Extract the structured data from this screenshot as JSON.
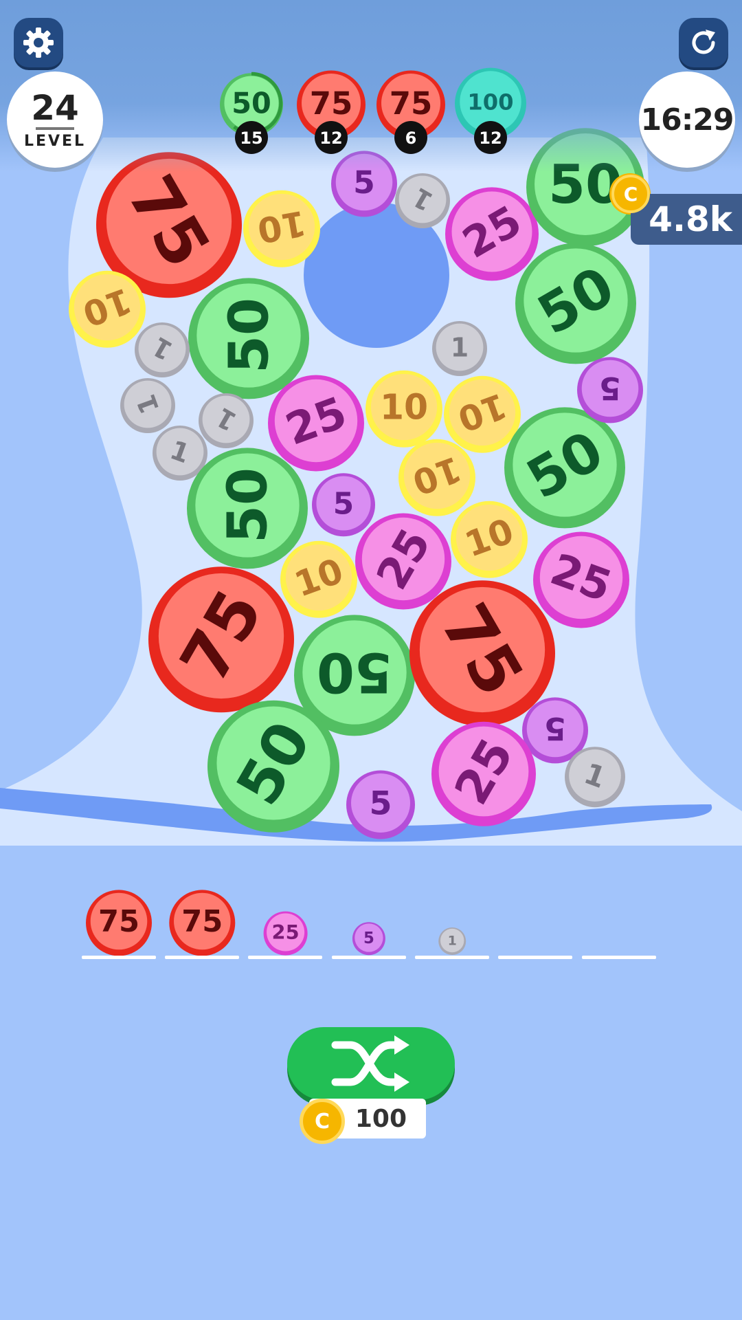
{
  "hud": {
    "level_number": "24",
    "level_label": "LEVEL",
    "timer": "16:29",
    "coin_balance": "4.8k",
    "coin_symbol": "C",
    "settings_icon": "gear-icon",
    "restart_icon": "restart-icon"
  },
  "goals": [
    {
      "value": "50",
      "count": "15",
      "color": "green",
      "progress": 0.6
    },
    {
      "value": "75",
      "count": "12",
      "color": "red"
    },
    {
      "value": "75",
      "count": "6",
      "color": "red"
    },
    {
      "value": "100",
      "count": "12",
      "color": "teal"
    }
  ],
  "board": {
    "coins": [
      {
        "value": "75",
        "color": "red"
      },
      {
        "value": "10",
        "color": "yellow"
      },
      {
        "value": "5",
        "color": "purple"
      },
      {
        "value": "1",
        "color": "gray"
      },
      {
        "value": "25",
        "color": "pink"
      },
      {
        "value": "50",
        "color": "green"
      },
      {
        "value": "10",
        "color": "yellow"
      },
      {
        "value": "50",
        "color": "green"
      },
      {
        "value": "50",
        "color": "green"
      },
      {
        "value": "1",
        "color": "gray"
      },
      {
        "value": "1",
        "color": "gray"
      },
      {
        "value": "1",
        "color": "gray"
      },
      {
        "value": "1",
        "color": "gray"
      },
      {
        "value": "1",
        "color": "gray"
      },
      {
        "value": "25",
        "color": "pink"
      },
      {
        "value": "10",
        "color": "yellow"
      },
      {
        "value": "10",
        "color": "yellow"
      },
      {
        "value": "5",
        "color": "purple"
      },
      {
        "value": "50",
        "color": "green"
      },
      {
        "value": "10",
        "color": "yellow"
      },
      {
        "value": "50",
        "color": "green"
      },
      {
        "value": "5",
        "color": "purple"
      },
      {
        "value": "25",
        "color": "pink"
      },
      {
        "value": "10",
        "color": "yellow"
      },
      {
        "value": "10",
        "color": "yellow"
      },
      {
        "value": "25",
        "color": "pink"
      },
      {
        "value": "75",
        "color": "red"
      },
      {
        "value": "50",
        "color": "green"
      },
      {
        "value": "75",
        "color": "red"
      },
      {
        "value": "5",
        "color": "purple"
      },
      {
        "value": "50",
        "color": "green"
      },
      {
        "value": "25",
        "color": "pink"
      },
      {
        "value": "1",
        "color": "gray"
      },
      {
        "value": "5",
        "color": "purple"
      }
    ]
  },
  "tray": {
    "slots": [
      {
        "value": "75",
        "color": "red"
      },
      {
        "value": "75",
        "color": "red"
      },
      {
        "value": "25",
        "color": "pink"
      },
      {
        "value": "5",
        "color": "purple"
      },
      {
        "value": "1",
        "color": "gray"
      },
      {
        "value": "",
        "color": ""
      },
      {
        "value": "",
        "color": ""
      }
    ]
  },
  "shuffle": {
    "icon": "shuffle-icon",
    "cost": "100",
    "coin_symbol": "C"
  },
  "colors": {
    "background": "#a2c4fb",
    "play_area": "#d6e6ff",
    "red": "#ff7b70",
    "green": "#8cf09a",
    "pink": "#f690e6",
    "purple": "#d98df2",
    "yellow": "#ffe07a",
    "gray": "#cfcfd6",
    "teal": "#4fe3cf",
    "shuffle_button": "#22bf55",
    "coin_gold": "#f6b600"
  }
}
